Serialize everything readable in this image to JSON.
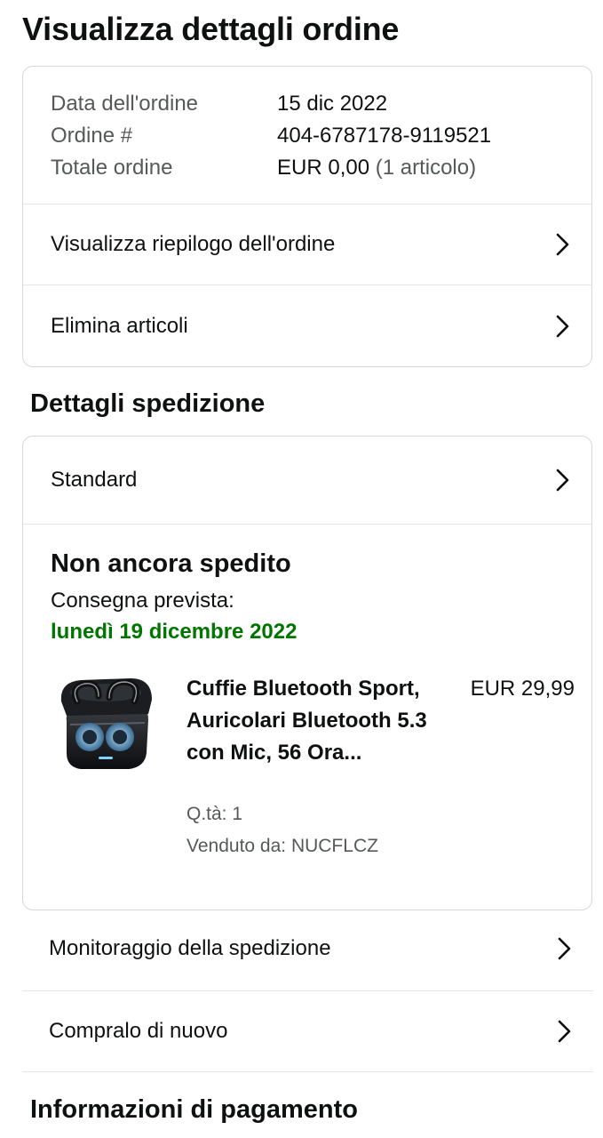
{
  "page": {
    "title": "Visualizza dettagli ordine"
  },
  "order": {
    "date_label": "Data dell'ordine",
    "date_value": "15 dic 2022",
    "number_label": "Ordine #",
    "number_value": "404-6787178-9119521",
    "total_label": "Totale ordine",
    "total_value": "EUR 0,00",
    "total_items": "(1 articolo)",
    "links": [
      {
        "label": "Visualizza riepilogo dell'ordine",
        "icon": "chevron-right-icon"
      },
      {
        "label": "Elimina articoli",
        "icon": "chevron-right-icon"
      }
    ]
  },
  "shipping": {
    "section_title": "Dettagli spedizione",
    "method": "Standard",
    "status": "Non ancora spedito",
    "delivery_label": "Consegna prevista:",
    "delivery_date": "lunedì 19 dicembre 2022",
    "delivery_date_color": "#007600",
    "product": {
      "title": "Cuffie Bluetooth Sport, Auricolari Bluetooth 5.3 con Mic, 56 Ora...",
      "price": "EUR 29,99",
      "quantity": "Q.tà: 1",
      "seller": "Venduto da: NUCFLCZ"
    },
    "actions": [
      {
        "label": "Monitoraggio della spedizione",
        "icon": "chevron-right-icon"
      },
      {
        "label": "Compralo di nuovo",
        "icon": "chevron-right-icon"
      }
    ]
  },
  "payment": {
    "section_title": "Informazioni di pagamento"
  },
  "colors": {
    "text": "#0f1111",
    "muted": "#565959",
    "border": "#d5d9d9",
    "divider": "#e3e6e6"
  }
}
